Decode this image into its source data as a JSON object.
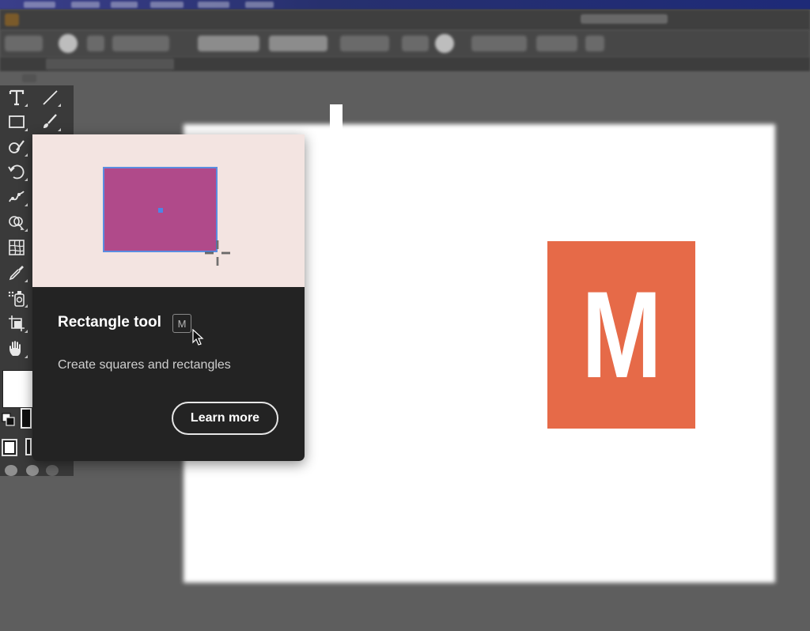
{
  "tooltip": {
    "title": "Rectangle tool",
    "shortcut": "M",
    "description": "Create squares and rectangles",
    "learn_more_label": "Learn more",
    "preview_bg": "#f3e4e1",
    "preview_rect_color": "#b04a8a",
    "selection_color": "#5a8de0"
  },
  "artboard": {
    "logo_letter": "M",
    "logo_color": "#e66a48"
  },
  "tools": [
    {
      "name": "type-tool",
      "icon": "type-icon"
    },
    {
      "name": "line-segment-tool",
      "icon": "line-icon"
    },
    {
      "name": "rectangle-tool",
      "icon": "rectangle-icon"
    },
    {
      "name": "paintbrush-tool",
      "icon": "paintbrush-icon"
    },
    {
      "name": "shaper-tool",
      "icon": "shaper-icon"
    },
    {
      "name": "rotate-tool",
      "icon": "rotate-icon"
    },
    {
      "name": "puppet-warp-tool",
      "icon": "puppet-warp-icon"
    },
    {
      "name": "shape-builder-tool",
      "icon": "shape-builder-icon"
    },
    {
      "name": "mesh-tool",
      "icon": "mesh-icon"
    },
    {
      "name": "eyedropper-tool",
      "icon": "eyedropper-icon"
    },
    {
      "name": "symbol-sprayer-tool",
      "icon": "symbol-sprayer-icon"
    },
    {
      "name": "artboard-tool",
      "icon": "artboard-icon"
    },
    {
      "name": "hand-tool",
      "icon": "hand-icon"
    }
  ],
  "colors": {
    "fill": "#ffffff",
    "stroke": "#111111"
  }
}
